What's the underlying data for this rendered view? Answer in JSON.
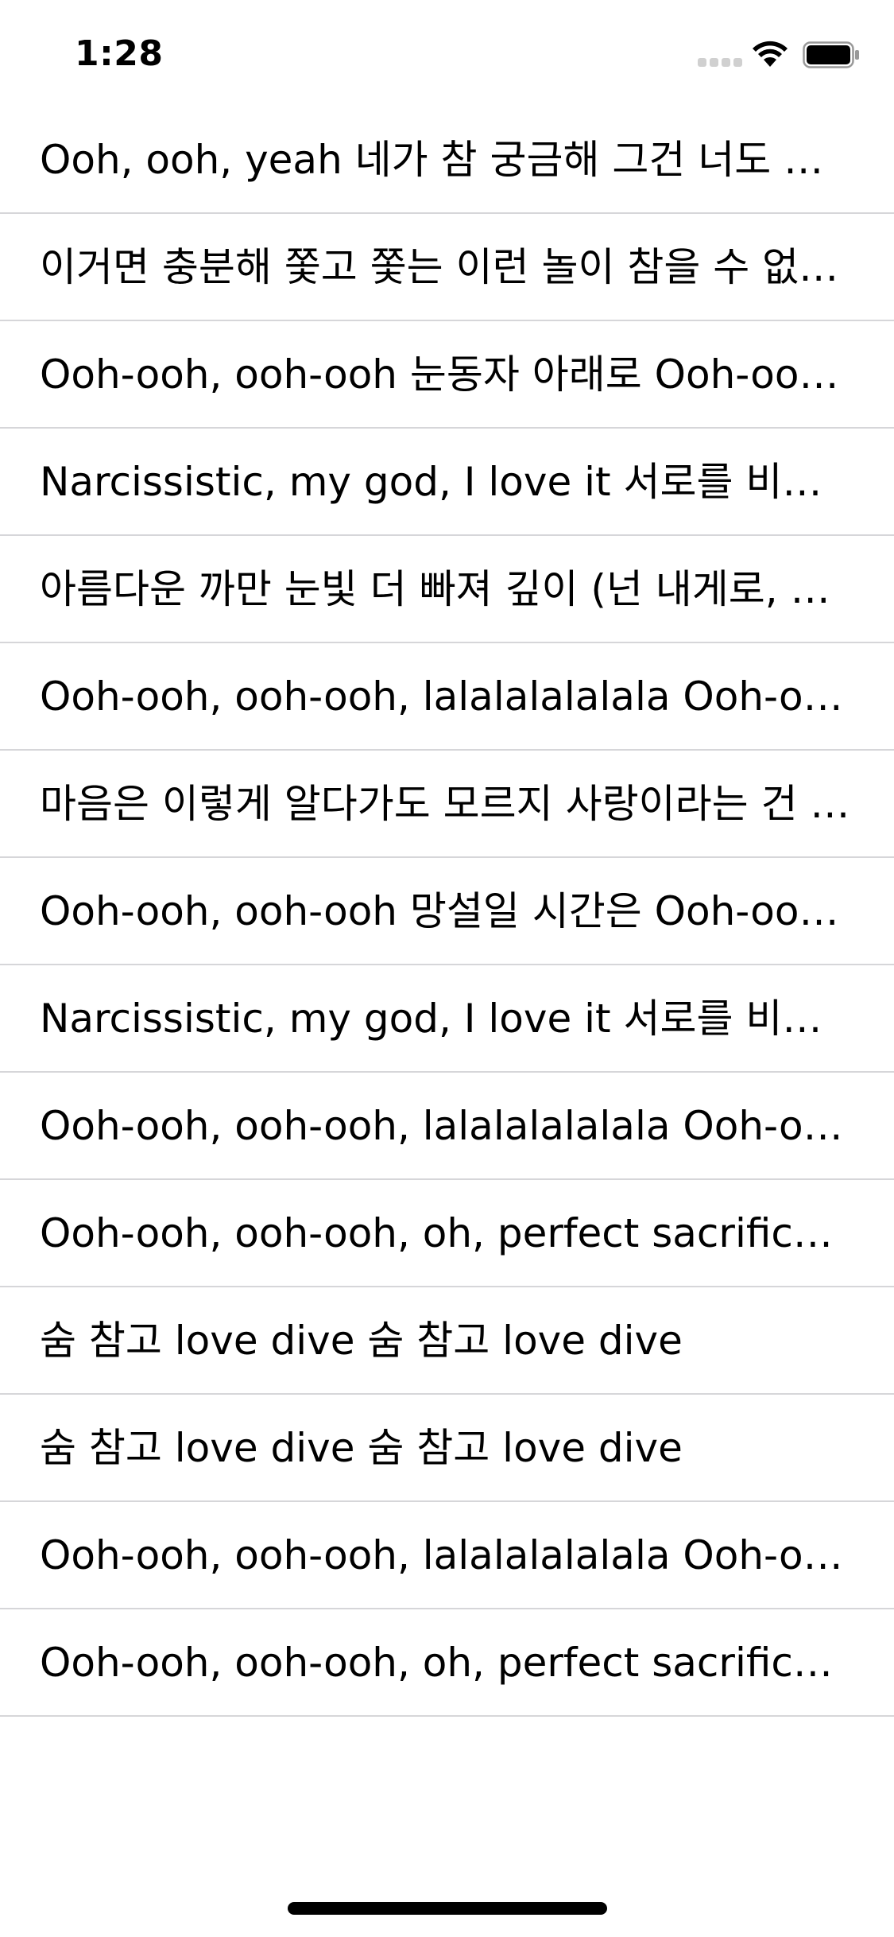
{
  "status_bar": {
    "time": "1:28",
    "signal_icon": "cellular-signal-icon",
    "wifi_icon": "wifi-icon",
    "battery_icon": "battery-icon"
  },
  "list": {
    "items": [
      {
        "label": "Ooh, ooh, yeah 네가 참 궁금해 그건 너도 마찬…"
      },
      {
        "label": "이거면 충분해 쫓고 쫓는 이런 놀이 참을 수 없는..."
      },
      {
        "label": "Ooh-ooh, ooh-ooh 눈동자 아래로 Ooh-ooh,..."
      },
      {
        "label": "Narcissistic, my god, I love it 서로를 비춘 밤"
      },
      {
        "label": "아름다운 까만 눈빛 더 빠져 깊이 (넌 내게로, 난..."
      },
      {
        "label": "Ooh-ooh, ooh-ooh, lalalalalalala Ooh-ooh,..."
      },
      {
        "label": "마음은 이렇게 알다가도 모르지 사랑이라는 건 한…"
      },
      {
        "label": "Ooh-ooh, ooh-ooh 망설일 시간은 Ooh-ooh,..."
      },
      {
        "label": "Narcissistic, my god, I love it 서로를 비춘 밤..."
      },
      {
        "label": "Ooh-ooh, ooh-ooh, lalalalalalala Ooh-ooh,..."
      },
      {
        "label": "Ooh-ooh, ooh-ooh, oh, perfect sacrifice Ye..."
      },
      {
        "label": "숨 참고 love dive 숨 참고 love dive"
      },
      {
        "label": "숨 참고 love dive 숨 참고 love dive"
      },
      {
        "label": "Ooh-ooh, ooh-ooh, lalalalalalala Ooh-ooh,..."
      },
      {
        "label": "Ooh-ooh, ooh-ooh, oh, perfect sacrifice Ye..."
      }
    ]
  }
}
